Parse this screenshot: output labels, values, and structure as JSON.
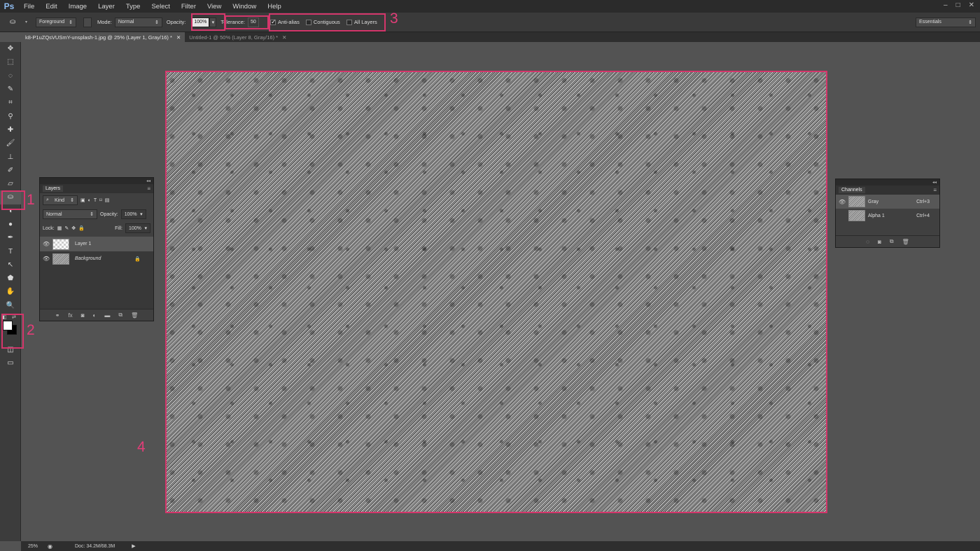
{
  "app": {
    "logo": "Ps"
  },
  "menu": [
    "File",
    "Edit",
    "Image",
    "Layer",
    "Type",
    "Select",
    "Filter",
    "View",
    "Window",
    "Help"
  ],
  "window_controls": [
    "–",
    "□",
    "✕"
  ],
  "options": {
    "fill_source": "Foreground",
    "mode_label": "Mode:",
    "mode_value": "Normal",
    "opacity_label": "Opacity:",
    "opacity_value": "100%",
    "tolerance_label": "Tolerance:",
    "tolerance_value": "50",
    "anti_alias_label": "Anti-alias",
    "anti_alias_checked": true,
    "contiguous_label": "Contiguous",
    "contiguous_checked": false,
    "all_layers_label": "All Layers",
    "all_layers_checked": false,
    "workspace": "Essentials"
  },
  "tabs": [
    {
      "label": "k8-P1uZQsVUSmY-unsplash-1.jpg @ 25% (Layer 1, Gray/16) *",
      "close": "✕",
      "active": true
    },
    {
      "label": "Untitled-1 @ 50% (Layer 8, Gray/16) *",
      "close": "✕",
      "active": false
    }
  ],
  "tools": [
    "move-icon",
    "marquee-icon",
    "lasso-icon",
    "quick-select-icon",
    "crop-icon",
    "eyedropper-icon",
    "healing-icon",
    "brush-icon",
    "stamp-icon",
    "history-brush-icon",
    "eraser-icon",
    "paint-bucket-icon",
    "smudge-icon",
    "dodge-icon",
    "pen-icon",
    "type-icon",
    "path-select-icon",
    "shape-icon",
    "hand-icon",
    "zoom-icon"
  ],
  "tool_glyphs": [
    "✥",
    "⬚",
    "◌",
    "✎",
    "⌗",
    "⚲",
    "✚",
    "🖌",
    "⊥",
    "✐",
    "▱",
    "⛀",
    "◖",
    "●",
    "✒",
    "T",
    "↖",
    "⬟",
    "✋",
    "🔍"
  ],
  "callouts": {
    "one": "1",
    "two": "2",
    "three": "3",
    "four": "4"
  },
  "layers_panel": {
    "tab": "Layers",
    "kind_label": "Kind",
    "blend_mode": "Normal",
    "opacity_label": "Opacity:",
    "opacity_value": "100%",
    "lock_label": "Lock:",
    "fill_label": "Fill:",
    "fill_value": "100%",
    "layers": [
      {
        "name": "Layer 1",
        "visible": true,
        "selected": true
      },
      {
        "name": "Background",
        "visible": true,
        "selected": false,
        "locked": true
      }
    ]
  },
  "channels_panel": {
    "tab": "Channels",
    "channels": [
      {
        "name": "Gray",
        "shortcut": "Ctrl+3",
        "visible": true
      },
      {
        "name": "Alpha 1",
        "shortcut": "Ctrl+4",
        "visible": false
      }
    ]
  },
  "status": {
    "zoom": "25%",
    "doc_size": "Doc: 34.2M/68.3M"
  },
  "colors": {
    "highlight": "#d4366b",
    "callout": "#e23d78",
    "foreground": "#ffffff",
    "background": "#000000"
  }
}
